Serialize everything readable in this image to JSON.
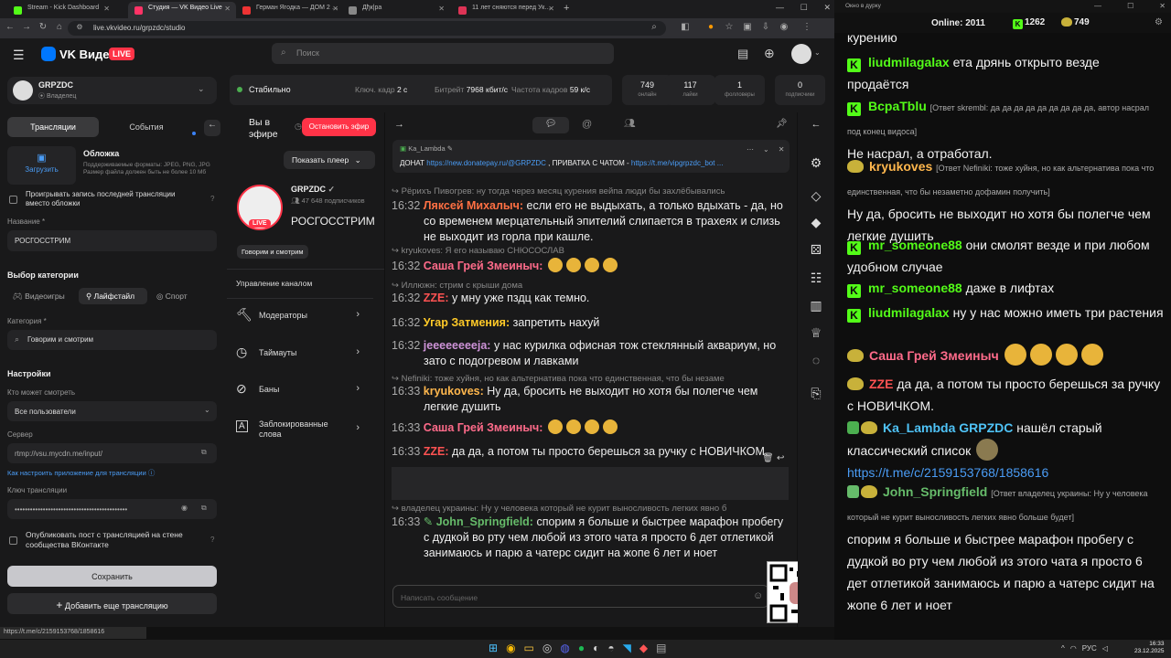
{
  "tabs": [
    {
      "title": "Stream - Kick Dashboard",
      "color": "#53fc18"
    },
    {
      "title": "Студия — VK Видео Live",
      "color": "#ff3366"
    },
    {
      "title": "Герман Ягодка — ДОМ 2 и ак",
      "color": "#e33"
    },
    {
      "title": "Дђк|ра",
      "color": "#888"
    },
    {
      "title": "11 лет сняются перед Украин",
      "color": "#d35"
    }
  ],
  "url": "live.vkvideo.ru/grpzdc/studio",
  "header": {
    "logo": "VK Видео",
    "live": "LIVE",
    "search_placeholder": "Поиск"
  },
  "channel": {
    "name": "GRPZDC",
    "role": "Владелец",
    "subs": "47 648 подписчиков",
    "title": "РОСГОССТРИМ",
    "category": "Говорим и смотрим",
    "live": "LIVE",
    "watch": "Вы в эфире",
    "stop": "Остановить эфир",
    "show_player": "Показать плеер"
  },
  "left": {
    "tab1": "Трансляции",
    "tab2": "События",
    "cover_title": "Обложка",
    "cover_btn": "Загрузить",
    "cover_desc": "Поддерживаемые форматы: JPEG, PNG, JPG Размер файла должен быть не более 10 Мб",
    "replay": "Проигрывать запись последней трансляции вместо обложки",
    "name_lbl": "Название *",
    "name_val": "РОСГОССТРИМ",
    "cat_hdr": "Выбор категории",
    "cats": [
      "Видеоигры",
      "Лайфстайл",
      "Спорт"
    ],
    "category_lbl": "Категория *",
    "category_val": "Говорим и смотрим",
    "settings": "Настройки",
    "who_lbl": "Кто может смотреть",
    "who_val": "Все пользователи",
    "server_lbl": "Сервер",
    "server_val": "rtmp://vsu.mycdn.me/input/",
    "howto": "Как настроить приложение для трансляции",
    "key_lbl": "Ключ трансляции",
    "key_val": "••••••••••••••••••••••••••••••••••••••••••••",
    "publish": "Опубликовать пост с трансляцией на стене сообщества ВКонтакте",
    "save": "Сохранить",
    "add": "Добавить еще трансляцию"
  },
  "stats": {
    "stable": "Стабильно",
    "keyframe_lbl": "Ключ. кадр",
    "keyframe": "2 с",
    "bitrate_lbl": "Битрейт",
    "bitrate": "7968 кбит/с",
    "fps_lbl": "Частота кадров",
    "fps": "59 к/с",
    "boxes": [
      {
        "v": "749",
        "k": "онлайн"
      },
      {
        "v": "117",
        "k": "лайки"
      },
      {
        "v": "1",
        "k": "фолловеры"
      },
      {
        "v": "0",
        "k": "подписчики"
      }
    ]
  },
  "manage": {
    "title": "Управление каналом",
    "items": [
      "Модераторы",
      "Таймауты",
      "Баны",
      "Заблокированные слова"
    ]
  },
  "pinned": {
    "user": "Ka_Lambda",
    "text": "ДОНАТ ",
    "link1": "https://new.donatepay.ru/@GRPZDC",
    "mid": " , ПРИВАТКА С ЧАТОМ - ",
    "link2": "https://t.me/vipgrpzdc_bot ..."
  },
  "chat": [
    {
      "reply": "Рёрихъ Пивогрев: ну тогда через месяц курения вейпа люди бы захлёбывались"
    },
    {
      "time": "16:32",
      "user": "Ляксей Михалыч:",
      "color": "#ff7043",
      "text": "если его не выдыхать, а только вдыхать - да, но со временем мерцательный эпителий слипается в трахеях и слизь не выходит из горла при кашле."
    },
    {
      "reply": "kryukoves: Я его называю СНЮСОСЛАВ"
    },
    {
      "time": "16:32",
      "user": "Саша Грей Змеиныч:",
      "color": "#ff6b8a",
      "text": ""
    },
    {
      "reply": "Иллюжн: стрим с крыши дома"
    },
    {
      "time": "16:32",
      "user": "ZZE:",
      "color": "#ff5252",
      "text": "у мну уже пздц как темно."
    },
    {
      "time": "16:32",
      "user": "Угар Затмения:",
      "color": "#ffca28",
      "text": "запретить нахуй"
    },
    {
      "time": "16:32",
      "user": "jeeeeeeeeja:",
      "color": "#ce93d8",
      "text": "у нас курилка офисная тож стеклянный аквариум, но зато с подогревом и лавками"
    },
    {
      "reply": "Nefiniki: тоже хуйня, но как альтернатива пока что единственная, что бы незаме"
    },
    {
      "time": "16:33",
      "user": "kryukoves:",
      "color": "#ffb74d",
      "text": "Ну да, бросить не выходит но хотя бы полегче чем легкие душить"
    },
    {
      "time": "16:33",
      "user": "Саша Грей Змеиныч:",
      "color": "#ff6b8a",
      "text": ""
    },
    {
      "time": "16:33",
      "user": "ZZE:",
      "color": "#ff5252",
      "text": "да да, а потом ты просто берешься за ручку с НОВИЧКОМ."
    },
    {
      "time": "16:33",
      "user": "Ka_Lambda:",
      "color": "#4fc3f7",
      "mention": "GRPZDC",
      "text": "нашёл старый классический список",
      "link": "https://t.me/c/2159153768/1858616"
    },
    {
      "reply": "владелец украины: Ну у человека который не курит выносливость легких явно б"
    },
    {
      "time": "16:33",
      "user": "John_Springfield:",
      "color": "#66bb6a",
      "text": "спорим  я больше и быстрее  марафон пробегу  с дудкой во рту чем любой из этого чата  я просто 6 дет отлетикой занимаюсь  и парю  а чатерс сидит на жопе 6 лет  и ноет"
    }
  ],
  "chat_input": "Написать сообщение",
  "obs": {
    "title": "Окно в дурку",
    "online_lbl": "Online:",
    "online": "2011",
    "kick": "1262",
    "vk": "749",
    "msgs": [
      {
        "plat": "",
        "user": "",
        "text": "курению"
      },
      {
        "plat": "kick",
        "user": "liudmilagalax",
        "color": "#53fc18",
        "text": "ета дрянь открыто везде продаётся"
      },
      {
        "plat": "kick",
        "user": "BcpaTblu",
        "color": "#53fc18",
        "reply": "[Ответ skrembl: да да да да да да да да да, автор насрал под конец видоса]",
        "text": "Не насрал, а отработал."
      },
      {
        "plat": "vk",
        "user": "kryukoves",
        "color": "#ffb74d",
        "reply": "[Ответ Nefiniki: тоже хуйня, но как альтернатива пока что единственная, что бы незаметно дофамин получить]",
        "text": "Ну да, бросить не выходит но хотя бы полегче чем легкие душить"
      },
      {
        "plat": "kick",
        "user": "mr_someone88",
        "color": "#53fc18",
        "text": "они смолят везде и при любом удобном случае"
      },
      {
        "plat": "kick",
        "user": "mr_someone88",
        "color": "#53fc18",
        "text": "даже в лифтах"
      },
      {
        "plat": "kick",
        "user": "liudmilagalax",
        "color": "#53fc18",
        "text": "ну у нас можно иметь три растения"
      },
      {
        "plat": "vk",
        "user": "Саша Грей Змеиныч",
        "color": "#ff6b8a",
        "text": ""
      },
      {
        "plat": "vk",
        "user": "ZZE",
        "color": "#ff5252",
        "text": "да да, а потом ты просто берешься за ручку с НОВИЧКОМ."
      },
      {
        "plat": "vk",
        "user": "Ka_Lambda",
        "color": "#4fc3f7",
        "mention": "GRPZDC",
        "text": "нашёл старый классический список",
        "link": "https://t.me/c/2159153768/1858616"
      },
      {
        "plat": "vk",
        "user": "John_Springfield",
        "color": "#66bb6a",
        "reply": "[Ответ владелец украины: Ну у человека который не курит выносливость легких явно больше будет]",
        "text": "спорим  я больше и быстрее  марафон пробегу  с дудкой во рту чем любой из этого чата  я просто 6 дет отлетикой занимаюсь  и парю  а чатерс сидит на жопе 6 лет  и ноет"
      }
    ]
  },
  "statusbar": "https://t.me/c/2159153768/1858616",
  "clock": {
    "time": "16:33",
    "date": "23.12.2025",
    "lang": "РУС"
  }
}
